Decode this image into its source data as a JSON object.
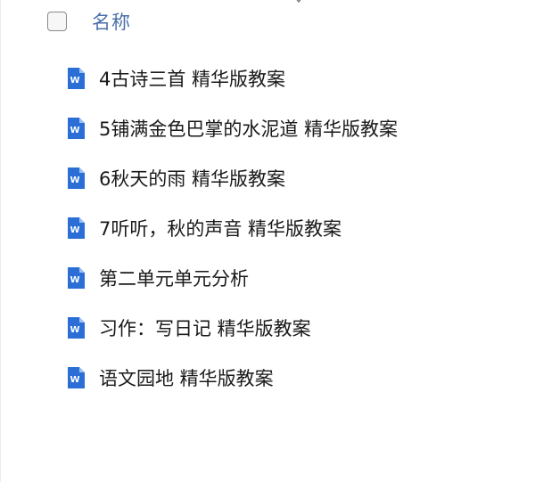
{
  "header": {
    "column_title": "名称"
  },
  "files": [
    {
      "name": "4古诗三首 精华版教案",
      "icon": "word-doc-icon"
    },
    {
      "name": "5铺满金色巴掌的水泥道 精华版教案",
      "icon": "word-doc-icon"
    },
    {
      "name": "6秋天的雨 精华版教案",
      "icon": "word-doc-icon"
    },
    {
      "name": "7听听，秋的声音 精华版教案",
      "icon": "word-doc-icon"
    },
    {
      "name": "第二单元单元分析",
      "icon": "word-doc-icon"
    },
    {
      "name": "习作：写日记 精华版教案",
      "icon": "word-doc-icon"
    },
    {
      "name": "语文园地 精华版教案",
      "icon": "word-doc-icon"
    }
  ],
  "colors": {
    "word_blue": "#2b6fd6",
    "header_text": "#4a6fa8"
  }
}
